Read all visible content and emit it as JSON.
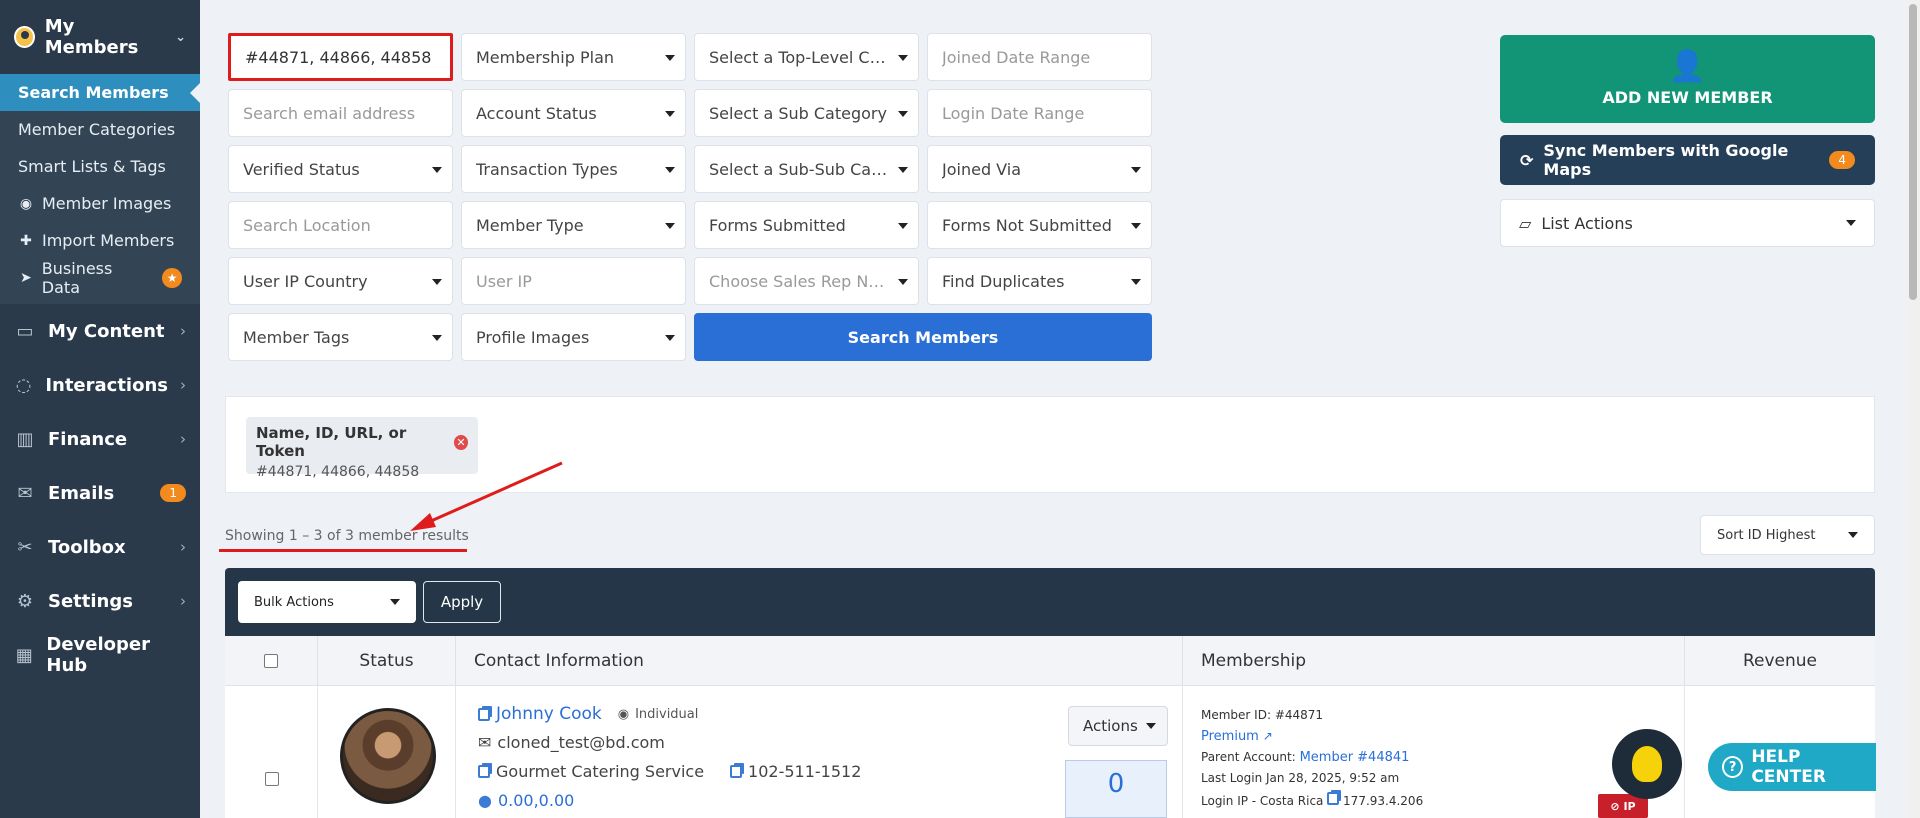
{
  "sidebar": {
    "header": "My Members",
    "subitems": [
      {
        "label": "Search Members"
      },
      {
        "label": "Member Categories"
      },
      {
        "label": "Smart Lists & Tags"
      },
      {
        "label": "Member Images"
      },
      {
        "label": "Import Members"
      },
      {
        "label": "Business Data"
      }
    ],
    "items": [
      {
        "label": "My Content"
      },
      {
        "label": "Interactions"
      },
      {
        "label": "Finance"
      },
      {
        "label": "Emails",
        "badge": "1"
      },
      {
        "label": "Toolbox"
      },
      {
        "label": "Settings"
      },
      {
        "label": "Developer Hub"
      }
    ]
  },
  "filters": {
    "name_query": "#44871, 44866, 44858",
    "membership_plan": "Membership Plan",
    "top_level_category": "Select a Top-Level Cat...",
    "joined_date_range": "Joined Date Range",
    "email_placeholder": "Search email address",
    "account_status": "Account Status",
    "sub_category": "Select a Sub Category",
    "login_date_range": "Login Date Range",
    "verified_status": "Verified Status",
    "transaction_types": "Transaction Types",
    "sub_sub_category": "Select a Sub-Sub Cate...",
    "joined_via": "Joined Via",
    "location_placeholder": "Search Location",
    "member_type": "Member Type",
    "forms_submitted": "Forms Submitted",
    "forms_not_submitted": "Forms Not Submitted",
    "user_ip_country": "User IP Country",
    "user_ip_placeholder": "User IP",
    "sales_rep": "Choose Sales Rep Na...",
    "find_duplicates": "Find Duplicates",
    "member_tags": "Member Tags",
    "profile_images": "Profile Images",
    "search_button": "Search Members"
  },
  "actions": {
    "add_member": "ADD NEW MEMBER",
    "sync_label": "Sync Members with Google Maps",
    "sync_badge": "4",
    "list_actions": "List Actions"
  },
  "active_filter": {
    "title": "Name, ID, URL, or Token",
    "value": "#44871, 44866, 44858"
  },
  "results": {
    "showing": "Showing 1 – 3 of 3 member results",
    "sort": "Sort ID Highest"
  },
  "table": {
    "bulk_actions": "Bulk Actions",
    "apply": "Apply",
    "columns": [
      "Status",
      "Contact Information",
      "Membership",
      "Revenue"
    ],
    "row": {
      "name": "Johnny Cook",
      "type": "Individual",
      "email": "cloned_test@bd.com",
      "company": "Gourmet Catering Service",
      "phone": "102-511-1512",
      "coords": "0.00,0.00",
      "actions": "Actions",
      "count": "0",
      "member_id_label": "Member ID:",
      "member_id": "#44871",
      "plan": "Premium",
      "parent_label": "Parent Account:",
      "parent_value": "Member #44841",
      "last_login_label": "Last Login",
      "last_login": "Jan 28, 2025, 9:52 am",
      "login_ip_label": "Login IP - Costa Rica",
      "login_ip": "177.93.4.206",
      "ip_badge": "IP"
    }
  },
  "help": {
    "label": "HELP CENTER"
  },
  "colors": {
    "sidebar_bg": "#2b3a4a",
    "active_item": "#2e8fbf",
    "primary": "#2a6fd6",
    "add_green": "#129477",
    "badge_orange": "#f28a1e",
    "annotation_red": "#e01b1b"
  }
}
